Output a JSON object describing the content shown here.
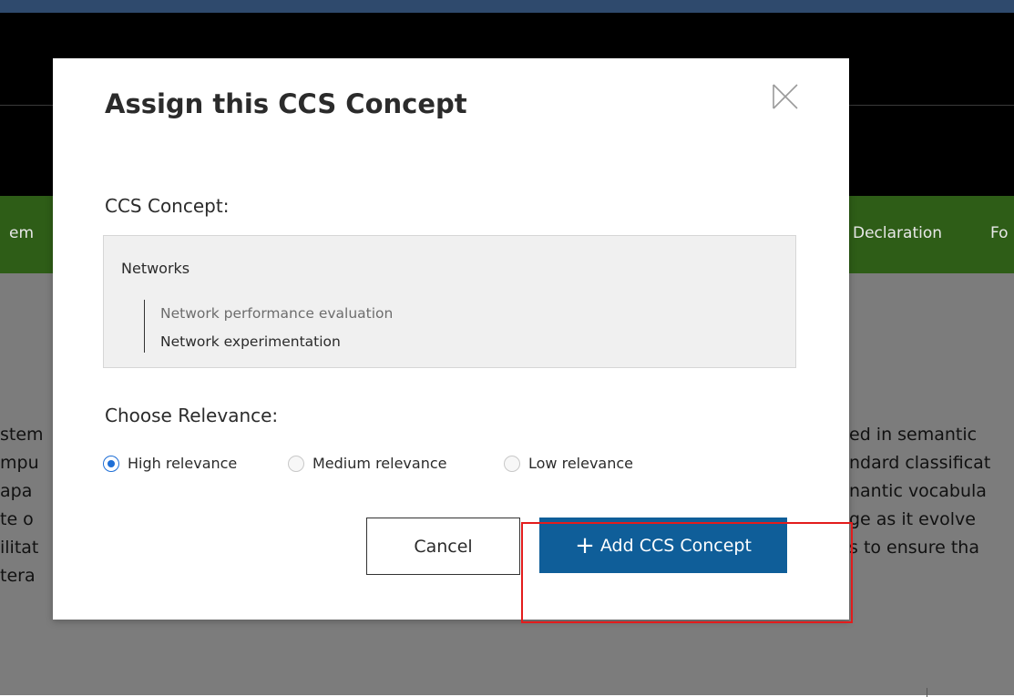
{
  "background": {
    "nav_items": [
      "em",
      "Declaration",
      "Fo"
    ],
    "left_fragments": [
      "stem",
      "mpu",
      "apa",
      "te o",
      "ilitat",
      "tera"
    ],
    "right_fragments": [
      "ed in semantic",
      "ndard classificat",
      "nantic vocabula",
      "ge as it evolve",
      "s to ensure tha"
    ]
  },
  "modal": {
    "title": "Assign this CCS Concept",
    "close_icon": "close-x-icon",
    "concept_label": "CCS Concept:",
    "concept": {
      "root": "Networks",
      "children": [
        "Network performance evaluation",
        "Network experimentation"
      ]
    },
    "relevance_label": "Choose Relevance:",
    "relevance_options": [
      {
        "label": "High relevance",
        "checked": true
      },
      {
        "label": "Medium relevance",
        "checked": false
      },
      {
        "label": "Low relevance",
        "checked": false
      }
    ],
    "cancel_label": "Cancel",
    "add_plus": "+",
    "add_label": "Add CCS Concept"
  },
  "colors": {
    "primary_button": "#0f5e99",
    "radio_accent": "#1f6fd6",
    "highlight": "#e31c1c",
    "nav_green": "#2e5d17"
  }
}
